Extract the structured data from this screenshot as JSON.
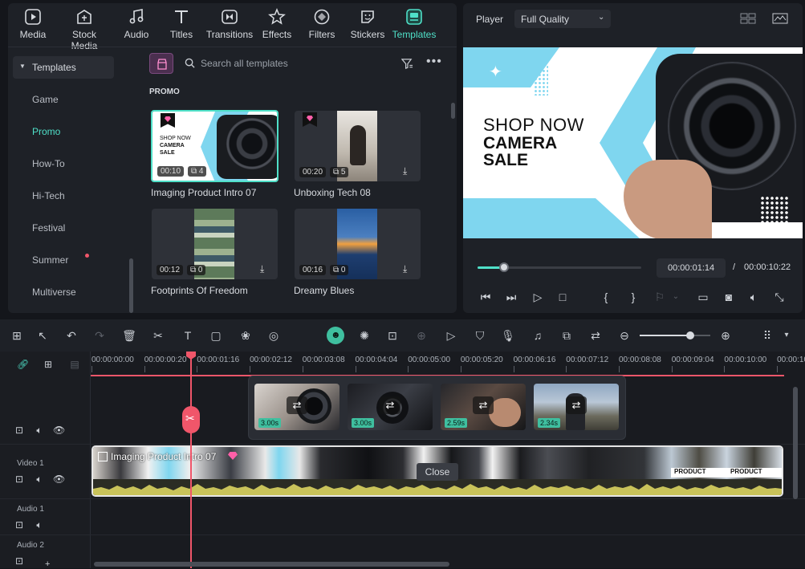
{
  "tabs": [
    {
      "label": "Media",
      "icon": "media-icon"
    },
    {
      "label": "Stock Media",
      "icon": "stock-media-icon"
    },
    {
      "label": "Audio",
      "icon": "music-note-icon"
    },
    {
      "label": "Titles",
      "icon": "text-icon"
    },
    {
      "label": "Transitions",
      "icon": "transitions-icon"
    },
    {
      "label": "Effects",
      "icon": "effects-icon"
    },
    {
      "label": "Filters",
      "icon": "filters-icon"
    },
    {
      "label": "Stickers",
      "icon": "stickers-icon"
    },
    {
      "label": "Templates",
      "icon": "templates-icon"
    }
  ],
  "sidebar": {
    "header": "Templates",
    "items": [
      "Game",
      "Promo",
      "How-To",
      "Hi-Tech",
      "Festival",
      "Summer",
      "Multiverse"
    ]
  },
  "search": {
    "placeholder": "Search all templates"
  },
  "section_label": "PROMO",
  "cards": [
    {
      "title": "Imaging Product Intro 07",
      "duration": "00:10",
      "count": "4"
    },
    {
      "title": "Unboxing Tech 08",
      "duration": "00:20",
      "count": "5"
    },
    {
      "title": "Footprints Of Freedom",
      "duration": "00:12",
      "count": "0"
    },
    {
      "title": "Dreamy Blues",
      "duration": "00:16",
      "count": "0"
    }
  ],
  "card_text": {
    "line1": "SHOP NOW",
    "line2": "CAMERA",
    "line3": "SALE"
  },
  "player": {
    "label": "Player",
    "quality": "Full Quality",
    "preview_line1": "SHOP NOW",
    "preview_line2": "CAMERA",
    "preview_line3": "SALE",
    "current_time": "00:00:01:14",
    "separator": "/",
    "total_time": "00:00:10:22",
    "progress": 0.16
  },
  "ruler": [
    "00:00:00:00",
    "00:00:00:20",
    "00:00:01:16",
    "00:00:02:12",
    "00:00:03:08",
    "00:00:04:04",
    "00:00:05:00",
    "00:00:05:20",
    "00:00:06:16",
    "00:00:07:12",
    "00:00:08:08",
    "00:00:09:04",
    "00:00:10:00",
    "00:00:10:2"
  ],
  "popup_clips": [
    "3.00s",
    "3.00s",
    "2.59s",
    "2.34s"
  ],
  "tracks": {
    "video1": "Video 1",
    "audio1": "Audio 1",
    "audio2": "Audio 2"
  },
  "timeline_clip_title": "Imaging Product Intro 07",
  "close_label": "Close",
  "product_label": "PRODUCT",
  "zoom_level": 0.72,
  "colors": {
    "accent": "#4fe0c8",
    "playhead": "#f0566a",
    "preview_blue": "#7fd6ef"
  }
}
